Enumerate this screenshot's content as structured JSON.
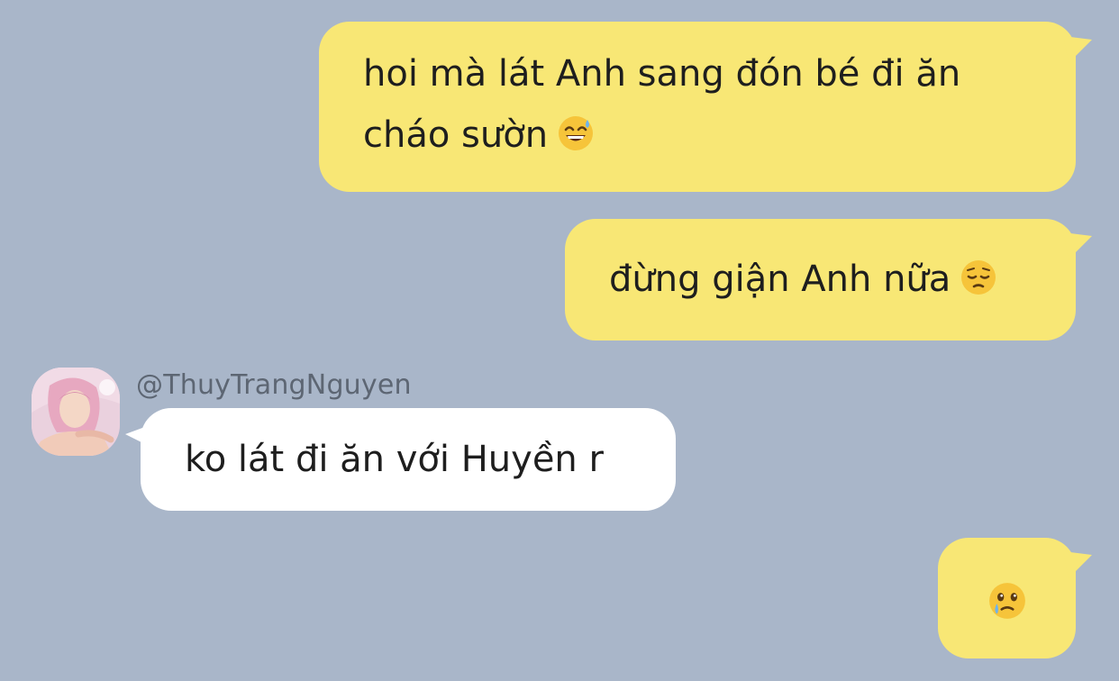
{
  "messages": [
    {
      "direction": "outgoing",
      "text": "hoi mà lát Anh sang đón bé đi ăn cháo sườn",
      "emoji_icon": "grinning-sweat-emoji"
    },
    {
      "direction": "outgoing",
      "text": "đừng giận Anh nữa",
      "emoji_icon": "pensive-emoji"
    },
    {
      "direction": "incoming",
      "sender": "@ThuyTrangNguyen",
      "text": "ko lát đi ăn với Huyền r"
    },
    {
      "direction": "outgoing",
      "text": "",
      "emoji_icon": "face-holding-back-tears-emoji"
    }
  ],
  "colors": {
    "background": "#a9b6c9",
    "outgoing_bubble": "#f8e775",
    "incoming_bubble": "#ffffff",
    "text": "#1e1e1e",
    "sender_name": "#5d6673"
  }
}
